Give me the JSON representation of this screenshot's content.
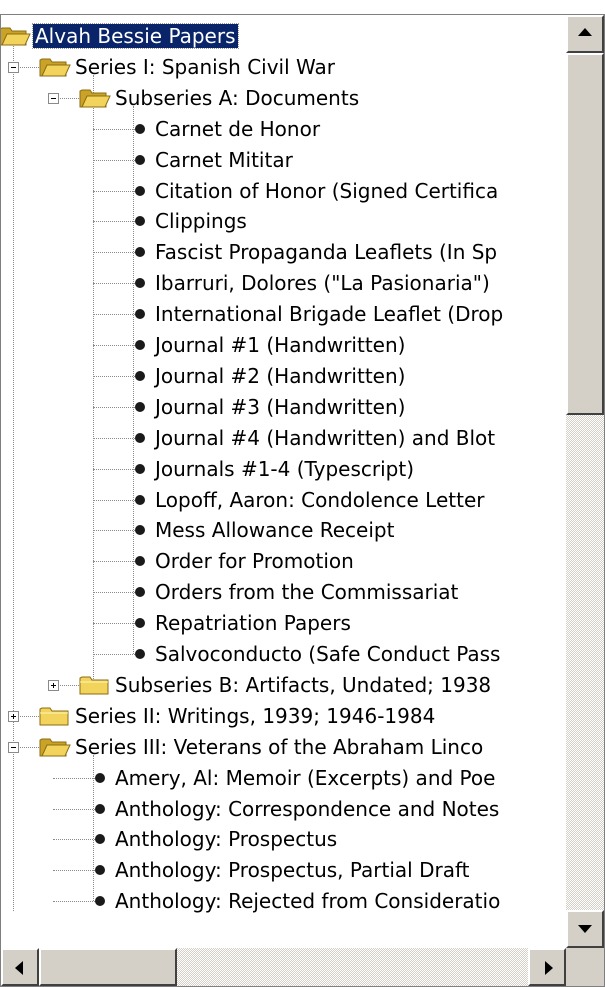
{
  "tree": {
    "items": [
      {
        "label": "Alvah Bessie Papers",
        "level": 0,
        "kind": "folder",
        "expanded": true,
        "selected": true,
        "toggle": false
      },
      {
        "label": "Series I: Spanish Civil War",
        "level": 1,
        "kind": "folder",
        "expanded": true,
        "toggle": true
      },
      {
        "label": "Subseries A: Documents",
        "level": 2,
        "kind": "folder",
        "expanded": true,
        "toggle": true
      },
      {
        "label": "Carnet de Honor",
        "level": 3,
        "kind": "item"
      },
      {
        "label": "Carnet Mititar",
        "level": 3,
        "kind": "item"
      },
      {
        "label": "Citation of Honor (Signed Certifica",
        "level": 3,
        "kind": "item"
      },
      {
        "label": "Clippings",
        "level": 3,
        "kind": "item"
      },
      {
        "label": "Fascist Propaganda Leaflets (In Sp",
        "level": 3,
        "kind": "item"
      },
      {
        "label": "Ibarruri, Dolores (\"La Pasionaria\")",
        "level": 3,
        "kind": "item"
      },
      {
        "label": "International Brigade Leaflet (Drop",
        "level": 3,
        "kind": "item"
      },
      {
        "label": "Journal #1 (Handwritten)",
        "level": 3,
        "kind": "item"
      },
      {
        "label": "Journal #2 (Handwritten)",
        "level": 3,
        "kind": "item"
      },
      {
        "label": "Journal #3 (Handwritten)",
        "level": 3,
        "kind": "item"
      },
      {
        "label": "Journal #4 (Handwritten) and Blot",
        "level": 3,
        "kind": "item"
      },
      {
        "label": "Journals #1-4 (Typescript)",
        "level": 3,
        "kind": "item"
      },
      {
        "label": "Lopoff, Aaron: Condolence Letter",
        "level": 3,
        "kind": "item"
      },
      {
        "label": "Mess Allowance Receipt",
        "level": 3,
        "kind": "item"
      },
      {
        "label": "Order for Promotion",
        "level": 3,
        "kind": "item"
      },
      {
        "label": "Orders from the Commissariat",
        "level": 3,
        "kind": "item"
      },
      {
        "label": "Repatriation Papers",
        "level": 3,
        "kind": "item"
      },
      {
        "label": "Salvoconducto (Safe Conduct Pass",
        "level": 3,
        "kind": "item"
      },
      {
        "label": "Subseries B: Artifacts, Undated; 1938",
        "level": 2,
        "kind": "folder",
        "expanded": false,
        "toggle": true
      },
      {
        "label": "Series II: Writings, 1939; 1946-1984",
        "level": 1,
        "kind": "folder",
        "expanded": false,
        "toggle": true
      },
      {
        "label": "Series III: Veterans of the Abraham Linco",
        "level": 1,
        "kind": "folder",
        "expanded": true,
        "toggle": true
      },
      {
        "label": "Amery, Al: Memoir (Excerpts) and Poe",
        "level": 2,
        "kind": "item"
      },
      {
        "label": "Anthology: Correspondence and Notes",
        "level": 2,
        "kind": "item"
      },
      {
        "label": "Anthology: Prospectus",
        "level": 2,
        "kind": "item"
      },
      {
        "label": "Anthology: Prospectus, Partial Draft",
        "level": 2,
        "kind": "item"
      },
      {
        "label": "Anthology: Rejected from Consideratio",
        "level": 2,
        "kind": "item"
      }
    ]
  },
  "icons": {
    "folder": "folder-icon",
    "open_folder": "folder-open-icon",
    "leaf": "bullet-icon",
    "expand": "plus-box-icon",
    "collapse": "minus-box-icon"
  },
  "colors": {
    "selection": "#0a246a",
    "folder": "#f2d35c",
    "scrollbar_face": "#d4d0c8"
  }
}
